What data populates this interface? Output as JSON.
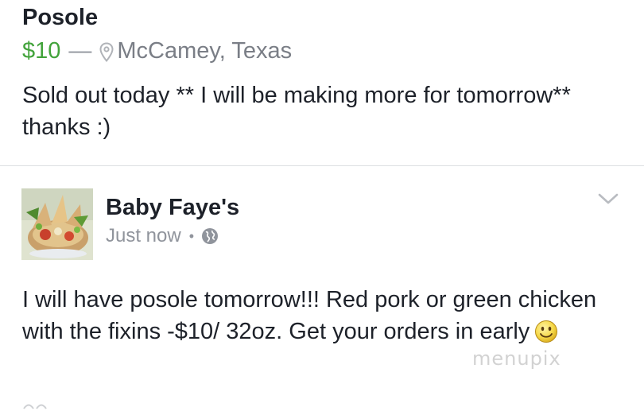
{
  "listing": {
    "title": "Posole",
    "price": "$10",
    "separator": "—",
    "location": "McCamey, Texas",
    "description": "Sold out today ** I will be making more for tomorrow** thanks :)",
    "colors": {
      "price": "#42a33b",
      "location": "#7a7e86"
    },
    "icons": {
      "location": "map-pin-icon"
    }
  },
  "post": {
    "author": "Baby Faye's",
    "timestamp": "Just now",
    "meta_separator": "•",
    "text": "I will have posole tomorrow!!! Red pork or green chicken with the fixins -$10/ 32oz. Get your orders in early",
    "icons": {
      "avatar": "food-photo-avatar",
      "privacy": "globe-icon",
      "menu": "chevron-down-icon",
      "emoji": "smiley-face-icon"
    }
  },
  "watermark": "menupix"
}
